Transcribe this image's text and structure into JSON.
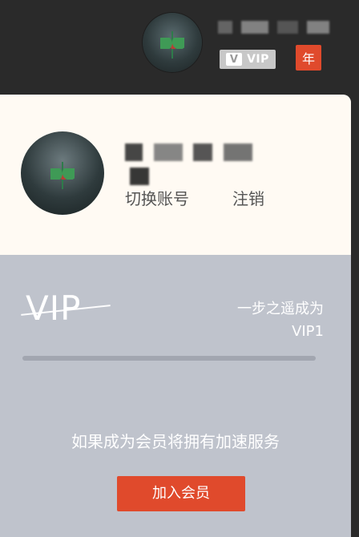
{
  "topbar": {
    "username": "",
    "vip_badge": {
      "v": "V",
      "label": "VIP"
    },
    "year_badge": "年"
  },
  "profile": {
    "name": "",
    "switch_account": "切换账号",
    "logout": "注销"
  },
  "vip_section": {
    "logo_text": "VIP",
    "step_text_line1": "一步之遥成为",
    "step_text_line2": "VIP1",
    "progress": 0,
    "benefit": "如果成为会员将拥有加速服务",
    "join": "加入会员"
  },
  "colors": {
    "accent": "#E04A2C",
    "panel_top": "#FFFAF3",
    "panel_bottom": "#BFC3CC",
    "dark_bg": "#2A2A2A"
  }
}
